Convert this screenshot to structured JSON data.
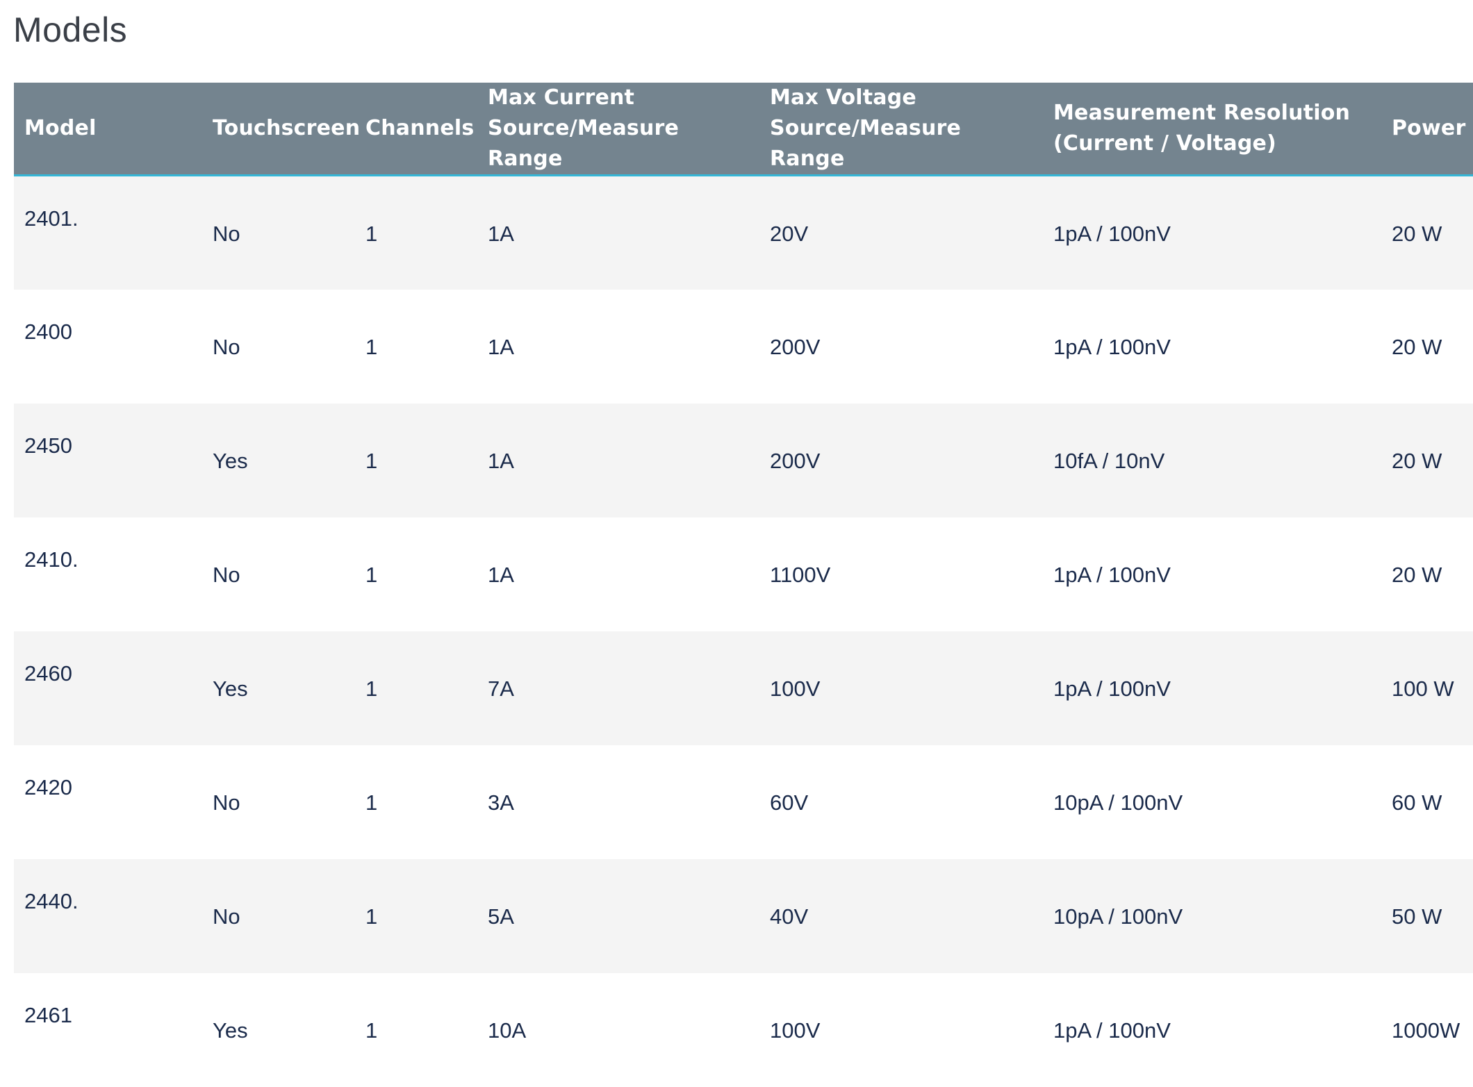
{
  "page": {
    "title": "Models"
  },
  "table": {
    "headers": {
      "model": "Model",
      "touchscreen": "Touchscreen",
      "channels": "Channels",
      "max_current_line1": "Max Current",
      "max_current_line2": "Source/Measure Range",
      "max_voltage_line1": "Max Voltage",
      "max_voltage_line2": "Source/Measure Range",
      "resolution_line1": "Measurement Resolution",
      "resolution_line2": "(Current / Voltage)",
      "power": "Power"
    },
    "rows": [
      {
        "model": "2401.",
        "touchscreen": "No",
        "channels": "1",
        "max_current": "1A",
        "max_voltage": "20V",
        "resolution": "1pA / 100nV",
        "power": "20 W"
      },
      {
        "model": "2400",
        "touchscreen": "No",
        "channels": "1",
        "max_current": "1A",
        "max_voltage": "200V",
        "resolution": "1pA / 100nV",
        "power": "20 W"
      },
      {
        "model": "2450",
        "touchscreen": "Yes",
        "channels": "1",
        "max_current": "1A",
        "max_voltage": "200V",
        "resolution": "10fA / 10nV",
        "power": "20 W"
      },
      {
        "model": "2410.",
        "touchscreen": "No",
        "channels": "1",
        "max_current": "1A",
        "max_voltage": "1100V",
        "resolution": "1pA / 100nV",
        "power": "20 W"
      },
      {
        "model": "2460",
        "touchscreen": "Yes",
        "channels": "1",
        "max_current": "7A",
        "max_voltage": "100V",
        "resolution": "1pA / 100nV",
        "power": "100 W"
      },
      {
        "model": "2420",
        "touchscreen": "No",
        "channels": "1",
        "max_current": "3A",
        "max_voltage": "60V",
        "resolution": "10pA / 100nV",
        "power": "60 W"
      },
      {
        "model": "2440.",
        "touchscreen": "No",
        "channels": "1",
        "max_current": "5A",
        "max_voltage": "40V",
        "resolution": "10pA / 100nV",
        "power": "50 W"
      },
      {
        "model": "2461",
        "touchscreen": "Yes",
        "channels": "1",
        "max_current": "10A",
        "max_voltage": "100V",
        "resolution": "1pA / 100nV",
        "power": "1000W"
      }
    ]
  },
  "colors": {
    "header_background": "#74848f",
    "header_border_accent": "#35b6d6",
    "row_stripe": "#f4f4f4",
    "text": "#1a2a4a"
  }
}
